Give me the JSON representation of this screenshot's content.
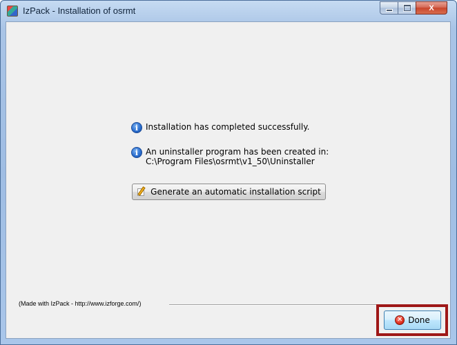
{
  "window": {
    "title": "IzPack - Installation of osrmt",
    "controls": {
      "minimize_icon": "minimize-icon",
      "maximize_icon": "maximize-icon",
      "close_glyph": "X"
    }
  },
  "messages": [
    {
      "icon": "info-icon",
      "icon_glyph": "i",
      "text": "Installation has completed successfully."
    },
    {
      "icon": "info-icon",
      "icon_glyph": "i",
      "text": "An uninstaller program has been created in:",
      "path": "C:\\Program Files\\osrmt\\v1_50\\Uninstaller"
    }
  ],
  "generate_button": {
    "icon": "pencil-notepad-icon",
    "label": "Generate an automatic installation script"
  },
  "footer": {
    "credit": "(Made with IzPack - http://www.izforge.com/)"
  },
  "done_button": {
    "icon": "cancel-icon",
    "icon_glyph": "✕",
    "label": "Done"
  },
  "colors": {
    "highlight": "#9e1717",
    "titlebar": "#a9c4e6",
    "client_bg": "#f0f0f0"
  }
}
